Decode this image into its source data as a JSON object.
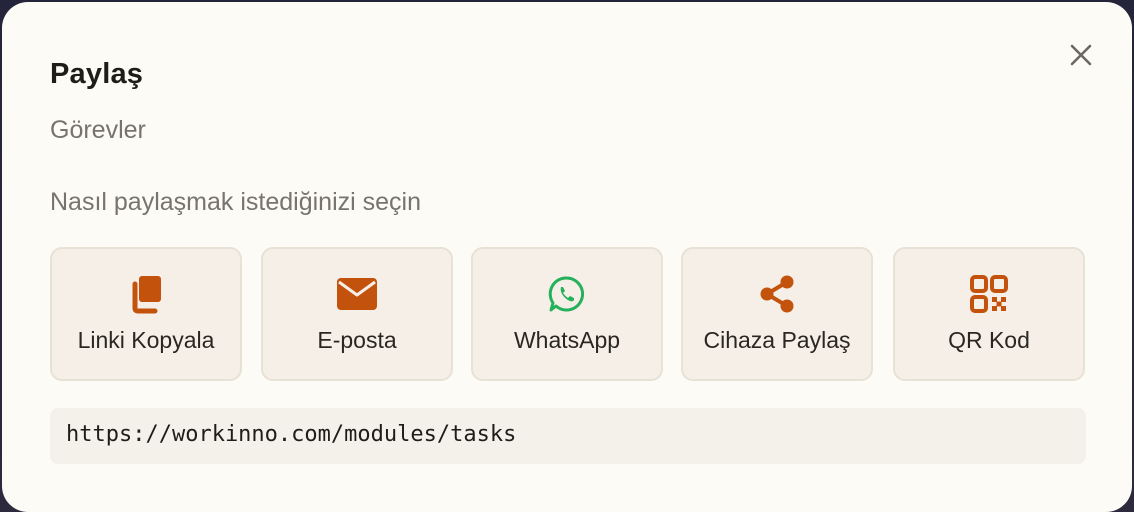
{
  "dialog": {
    "title": "Paylaş",
    "subtitle": "Görevler",
    "prompt": "Nasıl paylaşmak istediğinizi seçin",
    "close_icon": "close-icon"
  },
  "options": [
    {
      "label": "Linki Kopyala",
      "icon": "copy-icon"
    },
    {
      "label": "E-posta",
      "icon": "envelope-icon"
    },
    {
      "label": "WhatsApp",
      "icon": "whatsapp-icon"
    },
    {
      "label": "Cihaza Paylaş",
      "icon": "share-icon"
    },
    {
      "label": "QR Kod",
      "icon": "qr-code-icon"
    }
  ],
  "share_url": "https://workinno.com/modules/tasks",
  "colors": {
    "accent": "#c2520c",
    "whatsapp": "#25b05a",
    "card_bg": "#f5efe7",
    "dialog_bg": "#fdfbf5"
  }
}
